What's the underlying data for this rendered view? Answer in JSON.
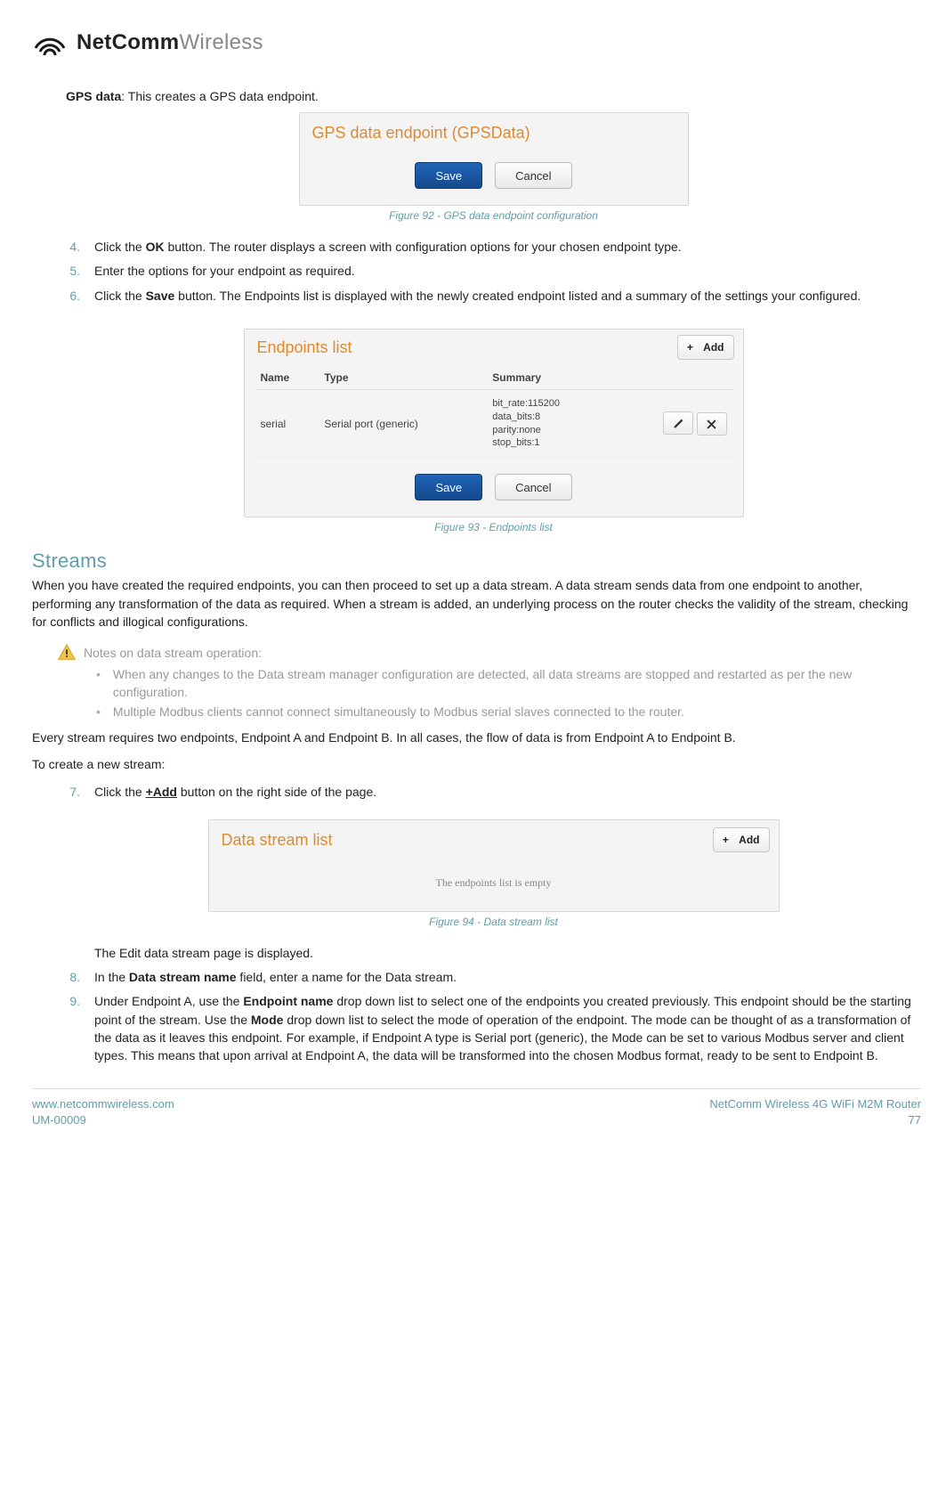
{
  "logo": {
    "bold": "NetComm",
    "light": "Wireless"
  },
  "intro": {
    "label": "GPS data",
    "text": ": This creates a GPS data endpoint."
  },
  "fig92": {
    "title": "GPS data endpoint (GPSData)",
    "save": "Save",
    "cancel": "Cancel",
    "caption": "Figure 92 - GPS data endpoint configuration"
  },
  "steps_a": {
    "n4": "4.",
    "t4a": "Click the ",
    "t4b": "OK",
    "t4c": " button. The router displays a screen with configuration options for your chosen endpoint type.",
    "n5": "5.",
    "t5": "Enter the options for your endpoint as required.",
    "n6": "6.",
    "t6a": "Click the ",
    "t6b": "Save",
    "t6c": " button. The Endpoints list is displayed with the newly created endpoint listed and a summary of the settings your configured."
  },
  "fig93": {
    "title": "Endpoints list",
    "add": "Add",
    "h_name": "Name",
    "h_type": "Type",
    "h_summary": "Summary",
    "row_name": "serial",
    "row_type": "Serial port (generic)",
    "s1": "bit_rate:115200",
    "s2": "data_bits:8",
    "s3": "parity:none",
    "s4": "stop_bits:1",
    "save": "Save",
    "cancel": "Cancel",
    "caption": "Figure 93 - Endpoints list"
  },
  "streams": {
    "heading": "Streams",
    "para1": "When you have created the required endpoints, you can then proceed to set up a data stream. A data stream sends data from one endpoint to another, performing any transformation of the data as required. When a stream is added, an underlying process on the router checks the validity of the stream, checking for conflicts and illogical configurations.",
    "note_title": "Notes on data stream operation:",
    "note1": "When any changes to the Data stream manager configuration are detected, all data streams are stopped and restarted as per the new configuration.",
    "note2": "Multiple Modbus clients cannot connect simultaneously to Modbus serial slaves connected to the router.",
    "para2": "Every stream requires two endpoints, Endpoint A and Endpoint B. In all cases, the flow of data is from Endpoint A to Endpoint B.",
    "para3": "To create a new stream:"
  },
  "steps_b": {
    "n7": "7.",
    "t7a": "Click the ",
    "t7b": "+Add",
    "t7c": " button on the right side of the page."
  },
  "fig94": {
    "title": "Data stream list",
    "add": "Add",
    "empty": "The endpoints list is empty",
    "caption": "Figure 94 - Data stream list"
  },
  "after": {
    "edit": "The Edit data stream page is displayed.",
    "n8": "8.",
    "t8a": "In the ",
    "t8b": "Data stream name",
    "t8c": " field, enter a name for the Data stream.",
    "n9": "9.",
    "t9a": "Under Endpoint A, use the ",
    "t9b": "Endpoint name",
    "t9c": " drop down list to select one of the endpoints you created previously. This endpoint should be the starting point of the stream. Use the ",
    "t9d": "Mode",
    "t9e": " drop down list to select the mode of operation of the endpoint. The mode can be thought of as a transformation of the data as it leaves this endpoint. For example, if Endpoint A type is Serial port (generic), the Mode can be set to various Modbus server and client types. This means that upon arrival at Endpoint A, the data will be transformed into the chosen Modbus format, ready to be sent to Endpoint B."
  },
  "footer": {
    "url": "www.netcommwireless.com",
    "doc": "UM-00009",
    "product": "NetComm Wireless 4G WiFi M2M Router",
    "page": "77"
  }
}
